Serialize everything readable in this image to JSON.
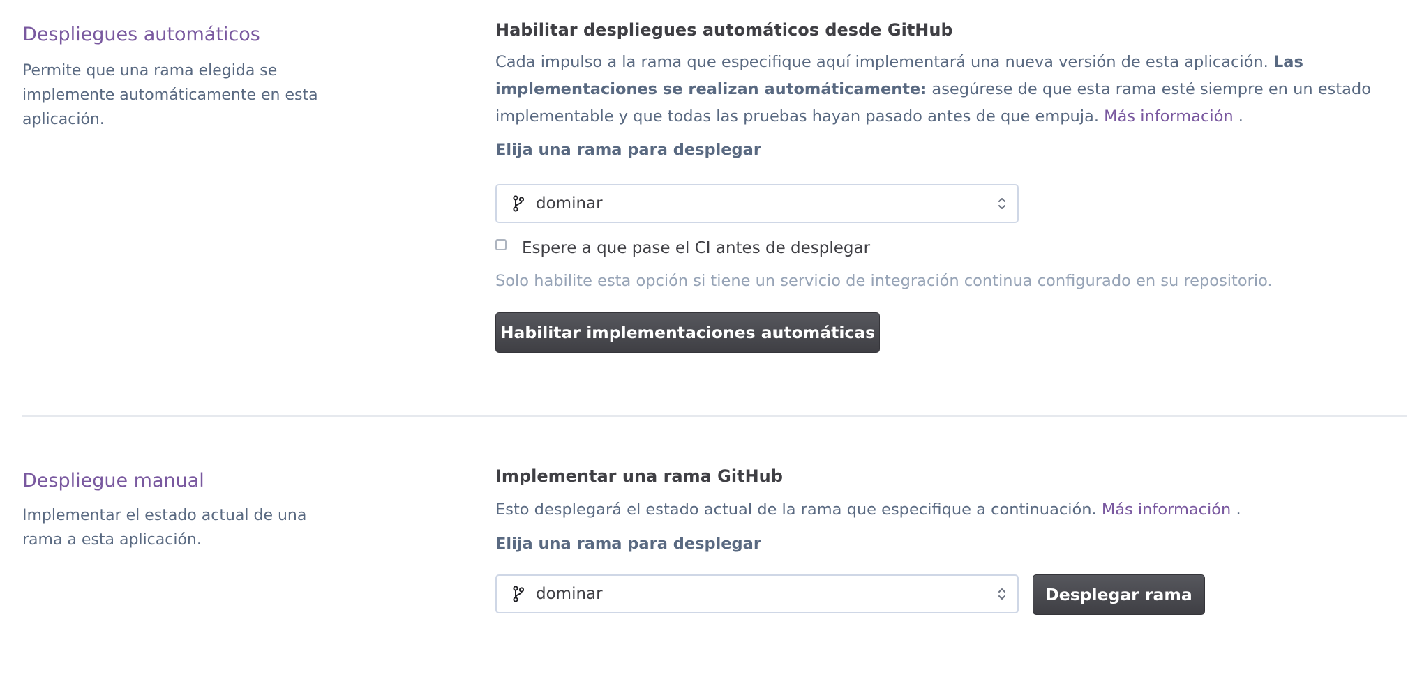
{
  "auto_deploy": {
    "section_title": "Despliegues automáticos",
    "section_description": "Permite que una rama elegida se implemente automáticamente en esta aplicación.",
    "subtitle": "Habilitar despliegues automáticos desde GitHub",
    "description_intro": "Cada impulso a la rama que especifique aquí implementará una nueva versión de esta aplicación. ",
    "description_bold": "Las implementaciones se realizan automáticamente:",
    "description_rest": " asegúrese de que esta rama esté siempre en un estado implementable y que todas las pruebas hayan pasado antes de que empuja. ",
    "learn_more_link": "Más información",
    "period": " .",
    "branch_label": "Elija una rama para desplegar",
    "branch_value": "dominar",
    "ci_checkbox_label": "Espere a que pase el CI antes de desplegar",
    "ci_checkbox_checked": false,
    "ci_hint": "Solo habilite esta opción si tiene un servicio de integración continua configurado en su repositorio.",
    "enable_button": "Habilitar implementaciones automáticas"
  },
  "manual_deploy": {
    "section_title": "Despliegue manual",
    "section_description": "Implementar el estado actual de una rama a esta aplicación.",
    "subtitle": "Implementar una rama GitHub",
    "description": "Esto desplegará el estado actual de la rama que especifique a continuación. ",
    "learn_more_link": "Más información",
    "period": " .",
    "branch_label": "Elija una rama para desplegar",
    "branch_value": "dominar",
    "deploy_button": "Desplegar rama"
  },
  "icons": {
    "branch": "git-branch-icon",
    "select_arrows": "chevron-up-down-icon"
  },
  "colors": {
    "accent": "#79589f",
    "body_text": "#596981",
    "hint_text": "#96a3b6",
    "button_bg": "#3f3f44"
  }
}
